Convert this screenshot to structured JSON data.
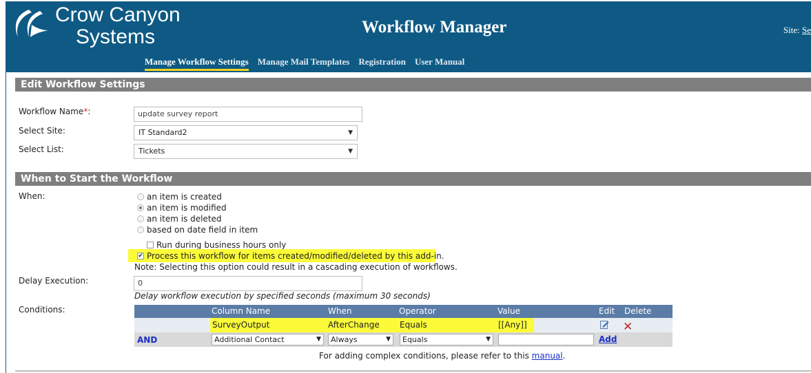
{
  "header": {
    "brand_line1": "Crow Canyon",
    "brand_line2": "Systems",
    "title": "Workflow Manager",
    "site_label": "Site:",
    "site_value": "Se",
    "colors": {
      "header_bg": "#0e5a84",
      "accent": "#f5d21b"
    }
  },
  "nav": {
    "items": [
      {
        "label": "Manage Workflow Settings",
        "active": true
      },
      {
        "label": "Manage Mail Templates"
      },
      {
        "label": "Registration"
      },
      {
        "label": "User Manual"
      }
    ]
  },
  "edit_settings": {
    "section_title": "Edit Workflow Settings",
    "workflow_name_label": "Workflow Name",
    "required_mark": "*",
    "colon": ":",
    "workflow_name_value": "update survey report",
    "select_site_label": "Select Site:",
    "select_site_value": "IT Standard2",
    "select_list_label": "Select List:",
    "select_list_value": "Tickets"
  },
  "start": {
    "section_title": "When to Start the Workflow",
    "when_label": "When:",
    "options": [
      {
        "label": "an item is created",
        "selected": false
      },
      {
        "label": "an item is modified",
        "selected": true
      },
      {
        "label": "an item is deleted",
        "selected": false
      },
      {
        "label": "based on date field in item",
        "selected": false
      }
    ],
    "business_hours_label": "Run during business hours only",
    "process_label": "Process this workflow for items created/modified/deleted by this add-in.",
    "note": "Note: Selecting this option could result in a cascading execution of workflows.",
    "delay_label": "Delay Execution:",
    "delay_value": "0",
    "delay_hint": "Delay workflow execution by specified seconds (maximum 30 seconds)",
    "conditions_label": "Conditions:"
  },
  "conditions": {
    "headers": {
      "column_name": "Column Name",
      "when": "When",
      "operator": "Operator",
      "value": "Value",
      "edit": "Edit",
      "delete": "Delete"
    },
    "rows": [
      {
        "column_name": "SurveyOutput",
        "when": "AfterChange",
        "operator": "Equals",
        "value": "[[Any]]"
      }
    ],
    "new_row": {
      "and_label": "AND",
      "column_value": "Additional Contact",
      "when_value": "Always",
      "operator_value": "Equals",
      "value_value": "",
      "add_label": "Add"
    },
    "footnote_prefix": "For adding complex conditions, please refer to this ",
    "footnote_link": "manual",
    "footnote_suffix": "."
  }
}
